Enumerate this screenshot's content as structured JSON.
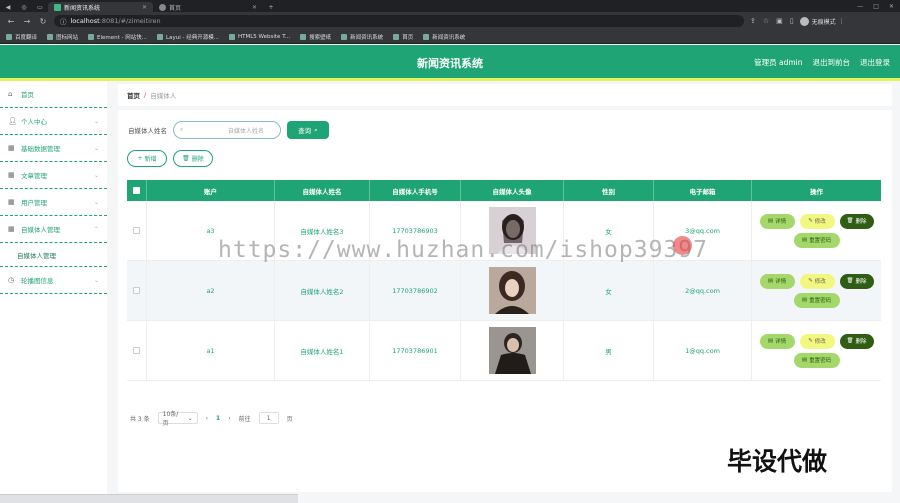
{
  "browser": {
    "tabs": [
      {
        "title": "新闻资讯系统",
        "active": true
      },
      {
        "title": "首页",
        "active": false
      }
    ],
    "url_host": "localhost",
    "url_rest": ":8081/#/zimeitiren",
    "profile_label": "无痕模式",
    "bookmarks": [
      "百度翻译",
      "图标网站",
      "Element - 网站快...",
      "Layui - 经典开源模...",
      "HTML5 Website T...",
      "搜索壁纸",
      "新闻资讯系统",
      "首页",
      "新闻资讯系统"
    ]
  },
  "header": {
    "title": "新闻资讯系统",
    "admin_label": "管理员 admin",
    "back_label": "退出到前台",
    "logout_label": "退出登录"
  },
  "sidebar": {
    "items": [
      {
        "label": "首页",
        "icon": "home-icon"
      },
      {
        "label": "个人中心",
        "icon": "user-icon"
      },
      {
        "label": "基础数据管理",
        "icon": "grid-icon"
      },
      {
        "label": "文章管理",
        "icon": "grid-icon"
      },
      {
        "label": "用户管理",
        "icon": "grid-icon"
      },
      {
        "label": "自媒体人管理",
        "icon": "grid-icon"
      }
    ],
    "active_sub": "自媒体人管理",
    "last_item": {
      "label": "轮播图信息",
      "icon": "clock-icon"
    }
  },
  "breadcrumb": {
    "home": "首页",
    "separator": "/",
    "current": "自媒体人"
  },
  "search": {
    "label": "自媒体人姓名",
    "placeholder": "自媒体人姓名",
    "button": "查询"
  },
  "actions": {
    "add": "新增",
    "delete": "删除"
  },
  "table": {
    "headers": [
      "账户",
      "自媒体人姓名",
      "自媒体人手机号",
      "自媒体人头像",
      "性别",
      "电子邮箱",
      "操作"
    ],
    "rows": [
      {
        "account": "a3",
        "name": "自媒体人姓名3",
        "phone": "17703786903",
        "sex": "女",
        "email": "3@qq.com"
      },
      {
        "account": "a2",
        "name": "自媒体人姓名2",
        "phone": "17703786902",
        "sex": "女",
        "email": "2@qq.com"
      },
      {
        "account": "a1",
        "name": "自媒体人姓名1",
        "phone": "17703786901",
        "sex": "男",
        "email": "1@qq.com"
      }
    ],
    "ops": {
      "detail": "详情",
      "edit": "修改",
      "remove": "删除",
      "reset": "重置密码"
    }
  },
  "pager": {
    "total": "共 3 条",
    "page_size": "10条/页",
    "current": "1",
    "goto": "前往",
    "goto_value": "1",
    "page_unit": "页"
  },
  "overlay": {
    "watermark": "https://www.huzhan.com/ishop39397",
    "badge": "毕设代做"
  }
}
